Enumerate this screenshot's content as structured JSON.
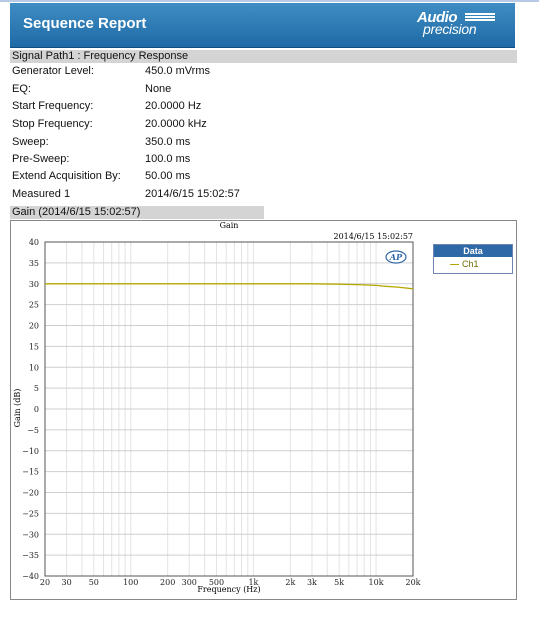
{
  "report": {
    "title": "Sequence Report",
    "brand_line1": "Audio",
    "brand_line2": "precision"
  },
  "section": {
    "title": "Signal Path1 : Frequency Response",
    "fields": [
      {
        "label": "Generator Level:",
        "value": "450.0 mVrms"
      },
      {
        "label": "EQ:",
        "value": "None"
      },
      {
        "label": "Start Frequency:",
        "value": "20.0000 Hz"
      },
      {
        "label": "Stop Frequency:",
        "value": "20.0000 kHz"
      },
      {
        "label": "Sweep:",
        "value": "350.0 ms"
      },
      {
        "label": "Pre-Sweep:",
        "value": "100.0 ms"
      },
      {
        "label": "Extend Acquisition By:",
        "value": "50.00 ms"
      },
      {
        "label": "Measured 1",
        "value": "2014/6/15 15:02:57"
      }
    ]
  },
  "graph_section": {
    "title": "Gain (2014/6/15 15:02:57)"
  },
  "chart_data": {
    "type": "line",
    "title": "Gain",
    "timestamp": "2014/6/15 15:02:57",
    "logo_text": "AP",
    "xlabel": "Frequency (Hz)",
    "ylabel": "Gain (dB)",
    "x_scale": "log",
    "xlim": [
      20,
      20000
    ],
    "ylim": [
      -40,
      40
    ],
    "x_ticks": [
      20,
      30,
      50,
      100,
      200,
      300,
      500,
      1000,
      2000,
      3000,
      5000,
      10000,
      20000
    ],
    "x_tick_labels": [
      "20",
      "30",
      "50",
      "100",
      "200",
      "300",
      "500",
      "1k",
      "2k",
      "3k",
      "5k",
      "10k",
      "20k"
    ],
    "y_ticks": [
      40,
      35,
      30,
      25,
      20,
      15,
      10,
      5,
      0,
      -5,
      -10,
      -15,
      -20,
      -25,
      -30,
      -35,
      -40
    ],
    "y_tick_labels": [
      "40",
      "35",
      "30",
      "25",
      "20",
      "15",
      "10",
      "5",
      "0",
      "−5",
      "−10",
      "−15",
      "−20",
      "−25",
      "−30",
      "−35",
      "−40"
    ],
    "grid": true,
    "legend_title": "Data",
    "legend_position": "right",
    "series": [
      {
        "name": "Ch1",
        "color": "#b5a800",
        "x": [
          20,
          50,
          100,
          200,
          500,
          1000,
          2000,
          3000,
          5000,
          7000,
          10000,
          12000,
          15000,
          20000
        ],
        "y": [
          30.0,
          30.0,
          30.0,
          30.0,
          30.0,
          30.0,
          30.0,
          30.0,
          29.9,
          29.8,
          29.6,
          29.4,
          29.2,
          28.8
        ]
      }
    ]
  }
}
